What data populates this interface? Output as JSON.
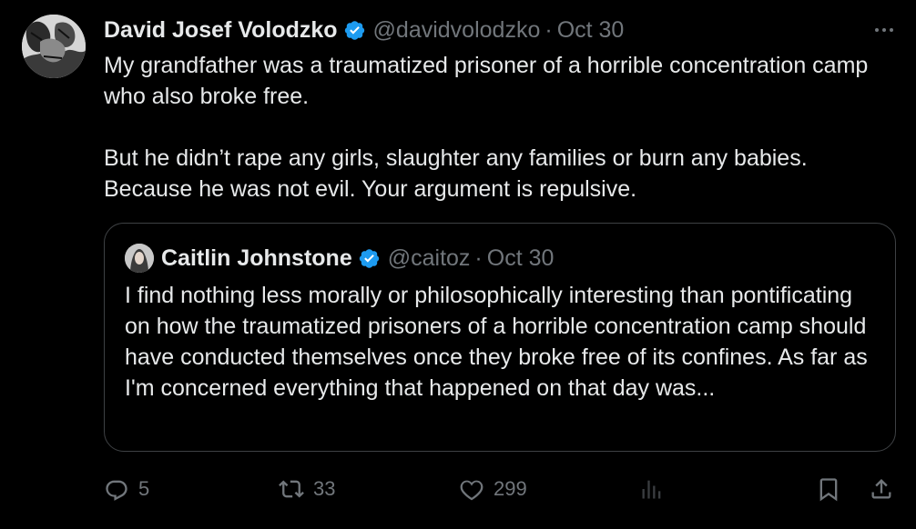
{
  "tweet": {
    "author_name": "David Josef Volodzko",
    "author_handle": "@davidvolodzko",
    "separator": "·",
    "date": "Oct 30",
    "paragraphs": [
      "My grandfather was a traumatized prisoner of a horrible concentration camp who also broke free.",
      "But he didn’t rape any girls, slaughter any families or burn any babies. Because he was not evil. Your argument is repulsive."
    ]
  },
  "quoted_tweet": {
    "author_name": "Caitlin Johnstone",
    "author_handle": "@caitoz",
    "separator": "·",
    "date": "Oct 30",
    "text": "I find nothing less morally or philosophically interesting than pontificating on how the traumatized prisoners of a horrible concentration camp should have conducted themselves once they broke free of its confines. As far as I'm concerned everything that happened on that day was..."
  },
  "actions": {
    "reply_count": "5",
    "retweet_count": "33",
    "like_count": "299"
  },
  "icons": {
    "verified": "verified-badge-icon",
    "more": "more-icon",
    "reply": "reply-icon",
    "retweet": "retweet-icon",
    "like": "heart-icon",
    "views": "views-icon",
    "bookmark": "bookmark-icon",
    "share": "share-icon"
  },
  "colors": {
    "background": "#000000",
    "primary_text": "#e7e9ea",
    "secondary_text": "#71767b",
    "verified_blue": "#1d9bf0",
    "quote_border": "#3e4144"
  }
}
